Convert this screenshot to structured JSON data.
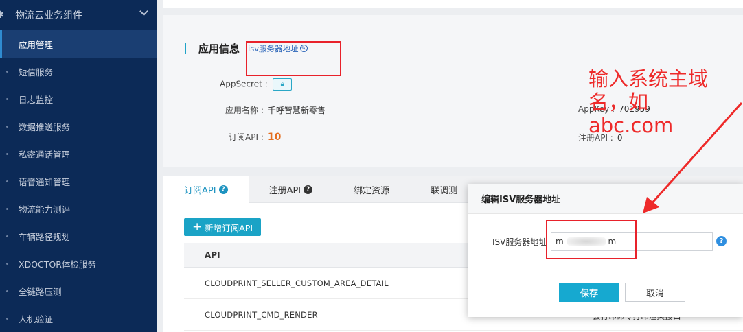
{
  "sidebar": {
    "group_label": "物流云业务组件",
    "group_icon": "puzzle-icon",
    "items": [
      {
        "label": "应用管理",
        "active": true
      },
      {
        "label": "短信服务"
      },
      {
        "label": "日志监控"
      },
      {
        "label": "数据推送服务"
      },
      {
        "label": "私密通话管理"
      },
      {
        "label": "语音通知管理"
      },
      {
        "label": "物流能力测评"
      },
      {
        "label": "车辆路径规划"
      },
      {
        "label": "XDOCTOR体检服务"
      },
      {
        "label": "全链路压测"
      },
      {
        "label": "人机验证"
      }
    ]
  },
  "app_info": {
    "title": "应用信息",
    "isv_link": "isv服务器地址",
    "app_secret_label": "AppSecret :",
    "app_name_label": "应用名称 :",
    "app_name_value": "千呼智慧新零售",
    "app_key_label": "AppKey :",
    "app_key_value": "701959",
    "subscribe_api_label": "订阅API :",
    "subscribe_api_count": "10",
    "register_api_label": "注册API :",
    "register_api_count": "0"
  },
  "tabs": [
    {
      "label": "订阅API",
      "help": true,
      "active": true
    },
    {
      "label": "注册API",
      "help": true
    },
    {
      "label": "绑定资源"
    },
    {
      "label": "联调测"
    }
  ],
  "add_button": "新增订阅API",
  "api_table": {
    "header": "API",
    "rows": [
      "CLOUDPRINT_SELLER_CUSTOM_AREA_DETAIL",
      "CLOUDPRINT_CMD_RENDER"
    ],
    "partial_text": "云打印命令打印渲染接口"
  },
  "annotation": {
    "line1": "输入系统主域",
    "line2": "名，如",
    "line3": "abc.com",
    "color": "#ee2a2a"
  },
  "modal": {
    "title": "编辑ISV服务器地址",
    "field_label": "ISV服务器地址",
    "field_value": "m                 m",
    "save": "保存",
    "cancel": "取消"
  },
  "colors": {
    "sidebar_bg": "#0c2a57",
    "accent": "#1aa3c6",
    "highlight_red": "#e8222b"
  }
}
